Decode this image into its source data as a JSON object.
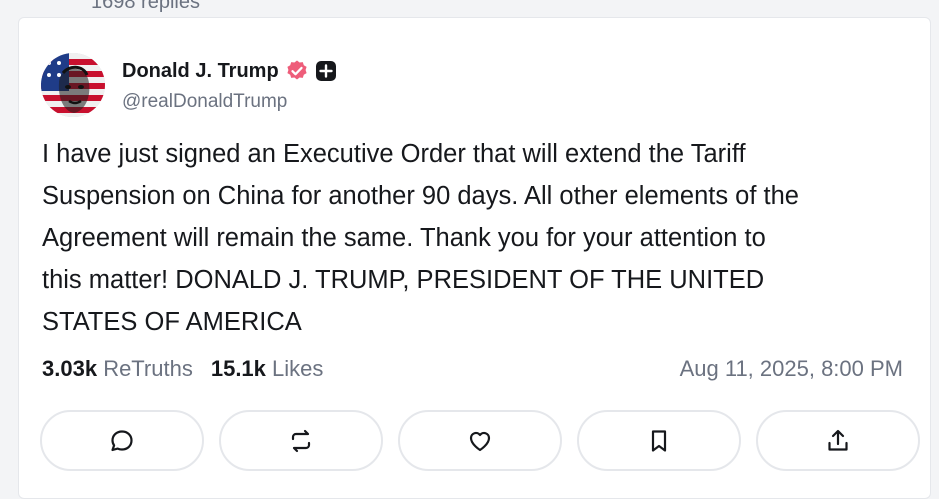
{
  "previous_post": {
    "replies_text": "1698 replies"
  },
  "post": {
    "author": {
      "display_name": "Donald J. Trump",
      "handle": "@realDonaldTrump",
      "avatar_icon": "avatar-flag-portrait",
      "verified_icon": "verified-badge-icon"
    },
    "text": "I have just signed an Executive Order that will extend the Tariff\nSuspension on China for another 90 days. All other elements of the\nAgreement will remain the same. Thank you for your attention to\nthis matter! DONALD J. TRUMP, PRESIDENT OF THE UNITED\nSTATES OF AMERICA",
    "retruths_count": "3.03k",
    "retruths_label": "ReTruths",
    "likes_count": "15.1k",
    "likes_label": "Likes",
    "timestamp": "Aug 11, 2025, 8:00 PM"
  },
  "actions": [
    "reply",
    "retruth",
    "like",
    "bookmark",
    "share"
  ],
  "colors": {
    "verified": "#ee5d7a",
    "muted": "#6b7280",
    "border": "#e5e7eb",
    "text": "#16181c"
  }
}
